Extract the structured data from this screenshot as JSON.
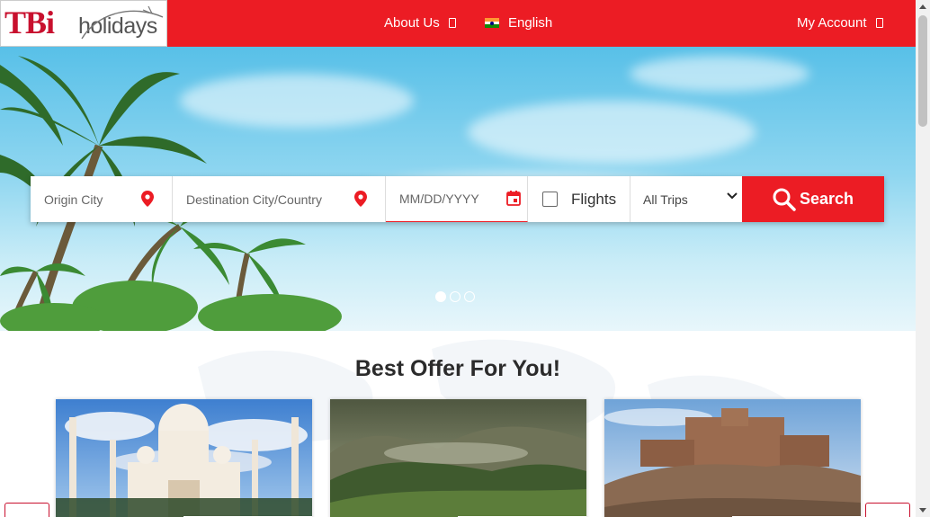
{
  "header": {
    "logo": {
      "brand": "TBi",
      "name": "holidays"
    },
    "nav": {
      "about_label": "About Us",
      "language_label": "English",
      "account_label": "My Account"
    },
    "accent_color": "#ec1c24"
  },
  "search": {
    "origin_placeholder": "Origin City",
    "destination_placeholder": "Destination City/Country",
    "date_placeholder": "MM/DD/YYYY",
    "flights_label": "Flights",
    "flights_checked": false,
    "trip_type_selected": "All Trips",
    "search_label": "Search"
  },
  "carousel": {
    "slide_count": 3,
    "active_index": 0
  },
  "offers": {
    "title": "Best Offer For You!",
    "cards": [
      {
        "image": "taj-mahal"
      },
      {
        "image": "tea-hills"
      },
      {
        "image": "fort"
      }
    ]
  },
  "icons": {
    "location": "map-pin-icon",
    "calendar": "calendar-icon",
    "search": "search-icon",
    "flag": "india-flag-icon"
  }
}
